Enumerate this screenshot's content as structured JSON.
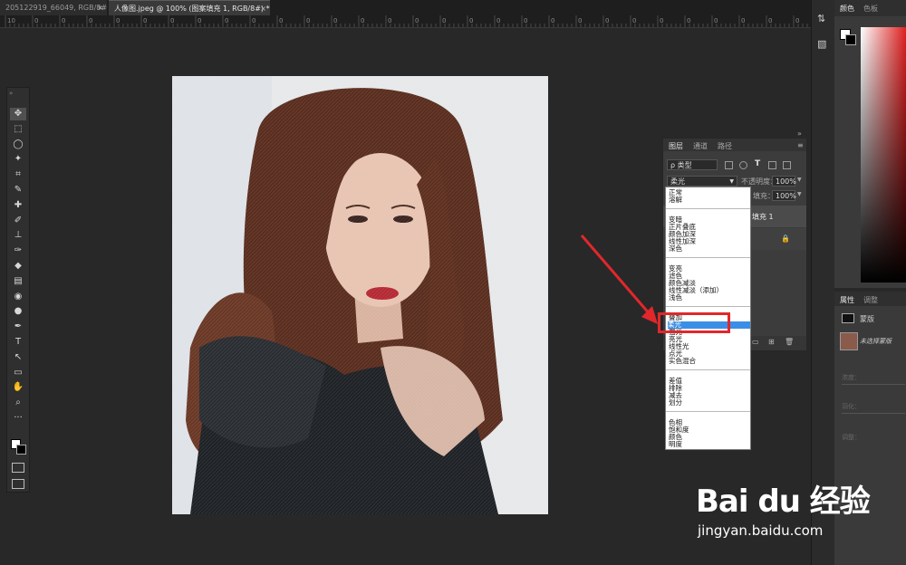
{
  "tabs": [
    {
      "label": "205122919_66049, RGB/8#) *",
      "close": "×"
    },
    {
      "label": "人像图.jpeg @ 100% (图案填充 1, RGB/8#) *",
      "close": "×"
    }
  ],
  "ruler_numbers": [
    "10",
    "0",
    "0",
    "0",
    "0",
    "0",
    "0",
    "0",
    "0",
    "0",
    "0",
    "0",
    "0",
    "0",
    "0",
    "0",
    "0",
    "0",
    "0",
    "0",
    "0",
    "0",
    "0",
    "0",
    "0",
    "0",
    "0",
    "0",
    "0",
    "0"
  ],
  "toolbar": {
    "tools": [
      "move-tool-icon",
      "marquee-tool-icon",
      "lasso-tool-icon",
      "magic-wand-icon",
      "crop-tool-icon",
      "eyedropper-icon",
      "healing-brush-icon",
      "brush-tool-icon",
      "stamp-tool-icon",
      "history-brush-icon",
      "eraser-icon",
      "gradient-icon",
      "blur-tool-icon",
      "dodge-tool-icon",
      "pen-tool-icon",
      "type-tool-icon",
      "path-select-icon",
      "rectangle-tool-icon",
      "hand-tool-icon",
      "zoom-tool-icon",
      "more-tools-icon"
    ],
    "glyphs": [
      "✥",
      "⬚",
      "◯",
      "✦",
      "⌗",
      "✎",
      "✚",
      "✐",
      "⊥",
      "✑",
      "◆",
      "▤",
      "◉",
      "●",
      "✒",
      "T",
      "↖",
      "▭",
      "✋",
      "⌕",
      "···"
    ]
  },
  "color_panel": {
    "tab_color": "颜色",
    "tab_swatch": "色板"
  },
  "props_panel": {
    "tab_props": "属性",
    "tab_adjust": "调整",
    "mask_label": "蒙版",
    "no_mask": "未选择蒙版",
    "density": "浓度：",
    "feather": "羽化：",
    "adjust": "调整："
  },
  "layers_panel": {
    "tabs": [
      "图层",
      "通道",
      "路径"
    ],
    "kind_label": "ρ 类型",
    "blend_mode": "柔光",
    "opacity_label": "不透明度：",
    "opacity_value": "100%",
    "fill_label": "填充：",
    "fill_value": "100%",
    "layer_name": "填充 1"
  },
  "blend_groups": [
    [
      "正常",
      "溶解"
    ],
    [
      "变暗",
      "正片叠底",
      "颜色加深",
      "线性加深",
      "深色"
    ],
    [
      "变亮",
      "滤色",
      "颜色减淡",
      "线性减淡（添加）",
      "浅色"
    ],
    [
      "叠加",
      "柔光",
      "强光",
      "亮光",
      "线性光",
      "点光",
      "实色混合"
    ],
    [
      "差值",
      "排除",
      "减去",
      "划分"
    ],
    [
      "色相",
      "饱和度",
      "颜色",
      "明度"
    ]
  ],
  "selected_blend": "柔光",
  "watermark": {
    "logo": "Bai du 经验",
    "url": "jingyan.baidu.com"
  },
  "colors": {
    "annotation_red": "#e1272b",
    "selection_blue": "#3a8ee6",
    "hair": "#5a2e1f",
    "dress": "#1f2226",
    "skin": "#e8c4b2",
    "lips": "#b52a35"
  }
}
